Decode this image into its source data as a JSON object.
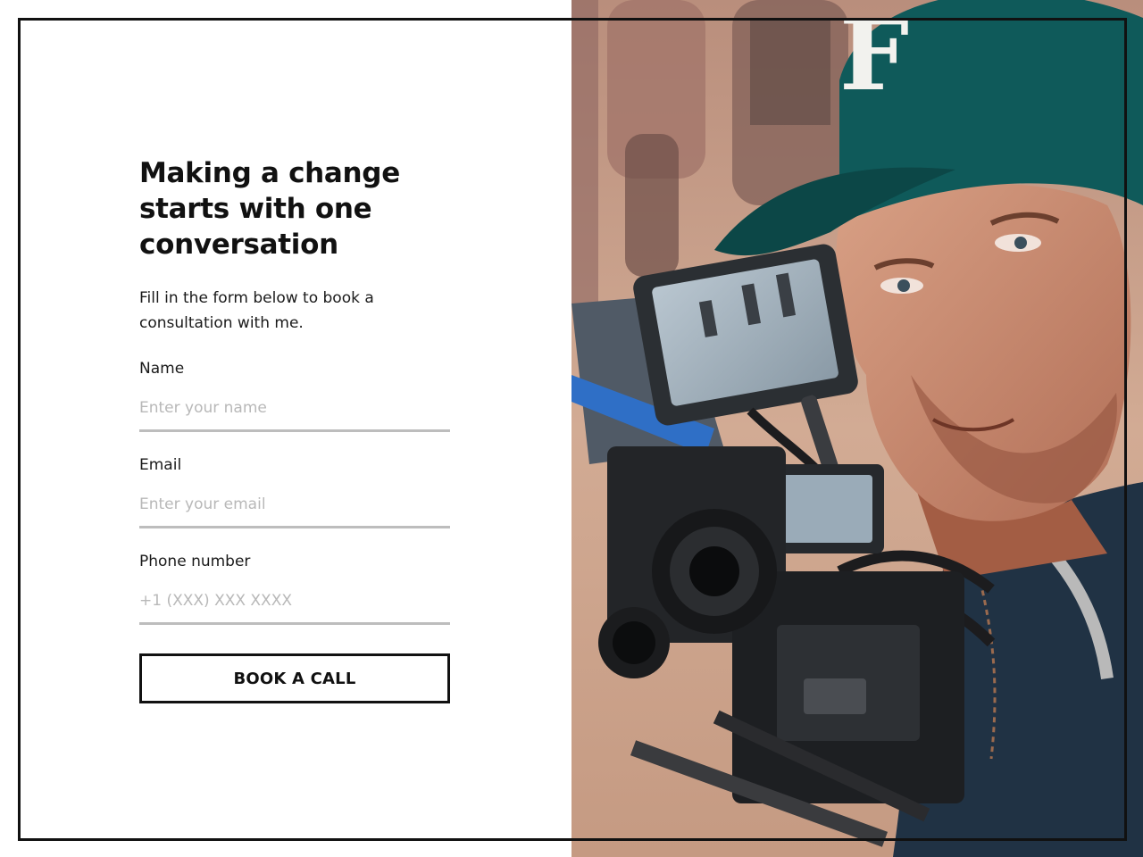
{
  "hero": {
    "title": "Making a change starts with one conversation",
    "subtitle": "Fill in the form below to book a consultation with me."
  },
  "form": {
    "name": {
      "label": "Name",
      "placeholder": "Enter your name",
      "value": ""
    },
    "email": {
      "label": "Email",
      "placeholder": "Enter your email",
      "value": ""
    },
    "phone": {
      "label": "Phone number",
      "placeholder": "+1 (XXX) XXX XXXX",
      "value": ""
    },
    "submit_label": "BOOK A CALL"
  },
  "photo": {
    "subject": "cameraman-with-cinema-camera-photo",
    "cap_letter": "F"
  },
  "colors": {
    "text": "#111111",
    "border": "#111111",
    "input_underline": "#bdbdbd",
    "placeholder": "#b8b8b8",
    "background": "#ffffff"
  }
}
